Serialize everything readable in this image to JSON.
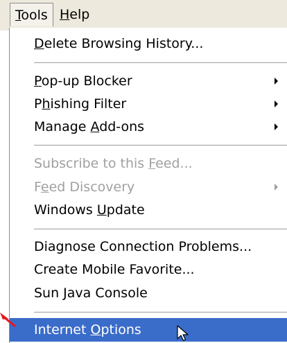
{
  "menubar": {
    "items": [
      {
        "label": "Tools",
        "mnemonic": "T",
        "rest": "ools"
      },
      {
        "label": "Help",
        "mnemonic": "H",
        "rest": "elp"
      }
    ]
  },
  "menu": {
    "delete_history": {
      "label": "Delete Browsing History...",
      "pre": "",
      "mnemonic": "D",
      "post": "elete Browsing History..."
    },
    "popup_blocker": {
      "label": "Pop-up Blocker",
      "pre": "",
      "mnemonic": "P",
      "post": "op-up Blocker"
    },
    "phishing_filter": {
      "label": "Phishing Filter",
      "pre": "P",
      "mnemonic": "h",
      "post": "ishing Filter"
    },
    "manage_addons": {
      "label": "Manage Add-ons",
      "pre": "Manage ",
      "mnemonic": "A",
      "post": "dd-ons"
    },
    "subscribe_feed": {
      "label": "Subscribe to this Feed...",
      "pre": "Subscribe to this ",
      "mnemonic": "F",
      "post": "eed..."
    },
    "feed_discovery": {
      "label": "Feed Discovery",
      "pre": "F",
      "mnemonic": "e",
      "post": "ed Discovery"
    },
    "windows_update": {
      "label": "Windows Update",
      "pre": "Windows ",
      "mnemonic": "U",
      "post": "pdate"
    },
    "diagnose": {
      "label": "Diagnose Connection Problems...",
      "pre": "Diagnose Connection Problems...",
      "mnemonic": "",
      "post": ""
    },
    "mobile_favorite": {
      "label": "Create Mobile Favorite...",
      "pre": "Create Mobile Favorite...",
      "mnemonic": "",
      "post": ""
    },
    "java_console": {
      "label": "Sun Java Console",
      "pre": "Sun Java Console",
      "mnemonic": "",
      "post": ""
    },
    "internet_options": {
      "label": "Internet Options",
      "pre": "Internet ",
      "mnemonic": "O",
      "post": "ptions"
    }
  },
  "colors": {
    "menubar_bg": "#ede9dc",
    "selected_bg": "#3a6cc9",
    "disabled_text": "#a0a0a0",
    "annotation_arrow": "#e8141b"
  },
  "icons": {
    "submenu": "submenu-arrow-icon",
    "cursor": "mouse-pointer-icon",
    "annotation": "red-arrow-icon"
  }
}
